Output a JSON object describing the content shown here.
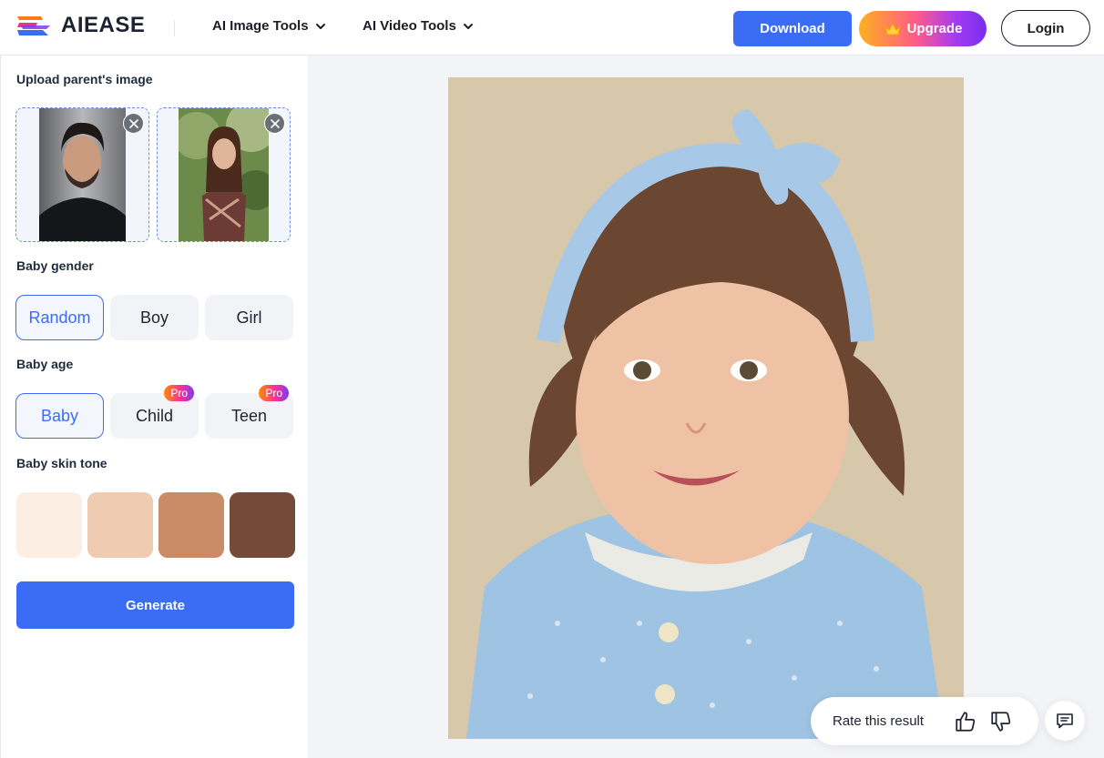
{
  "header": {
    "brand": "AIEASE",
    "nav": [
      {
        "label": "AI Image Tools"
      },
      {
        "label": "AI Video Tools"
      }
    ],
    "download_label": "Download",
    "upgrade_label": "Upgrade",
    "login_label": "Login"
  },
  "sidebar": {
    "upload_title": "Upload parent's image",
    "gender_title": "Baby gender",
    "gender_options": [
      "Random",
      "Boy",
      "Girl"
    ],
    "gender_selected": "Random",
    "age_title": "Baby age",
    "age_options": [
      "Baby",
      "Child",
      "Teen"
    ],
    "age_selected": "Baby",
    "pro_badge": "Pro",
    "skin_title": "Baby skin tone",
    "skin_tones": [
      "#fdeee4",
      "#efcbb1",
      "#c98c66",
      "#744b39"
    ],
    "generate_label": "Generate"
  },
  "result": {
    "rate_label": "Rate this result"
  },
  "colors": {
    "accent": "#3a6cf6",
    "panel_bg": "#f3f4f7"
  }
}
